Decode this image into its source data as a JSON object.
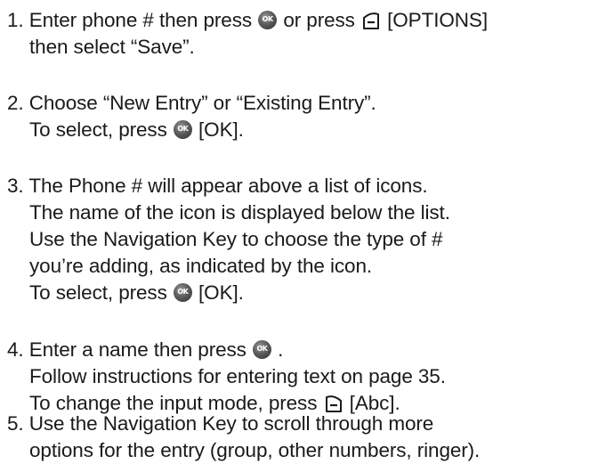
{
  "steps": [
    {
      "number": "1.",
      "lines": [
        {
          "t1": "Enter phone # then press ",
          "t2": " or press ",
          "t3": " [OPTIONS]"
        },
        "then select “Save”."
      ]
    },
    {
      "number": "2.",
      "lines": [
        "Choose “New Entry” or “Existing Entry”.",
        {
          "t1": "To select, press ",
          "t2": " [OK]."
        }
      ]
    },
    {
      "number": "3.",
      "lines": [
        "The Phone # will appear above a list of icons.",
        "The name of the icon is displayed below the list.",
        "Use the Navigation Key to choose the type of #",
        "you’re adding, as indicated by the icon.",
        {
          "t1": "To select, press ",
          "t2": " [OK]."
        }
      ]
    },
    {
      "number": "4.",
      "lines": [
        {
          "t1": "Enter a name then press ",
          "t2": " ."
        },
        "Follow instructions for entering text on page 35.",
        {
          "t1": "To change the input mode, press ",
          "t2": " [Abc]."
        }
      ]
    },
    {
      "number": "5.",
      "lines": [
        "Use the Navigation Key to scroll through more",
        "options for the entry (group, other numbers, ringer)."
      ]
    }
  ],
  "icons": {
    "ok": "ok-key-icon",
    "left_soft": "left-soft-key-icon",
    "right_soft": "right-soft-key-icon"
  }
}
